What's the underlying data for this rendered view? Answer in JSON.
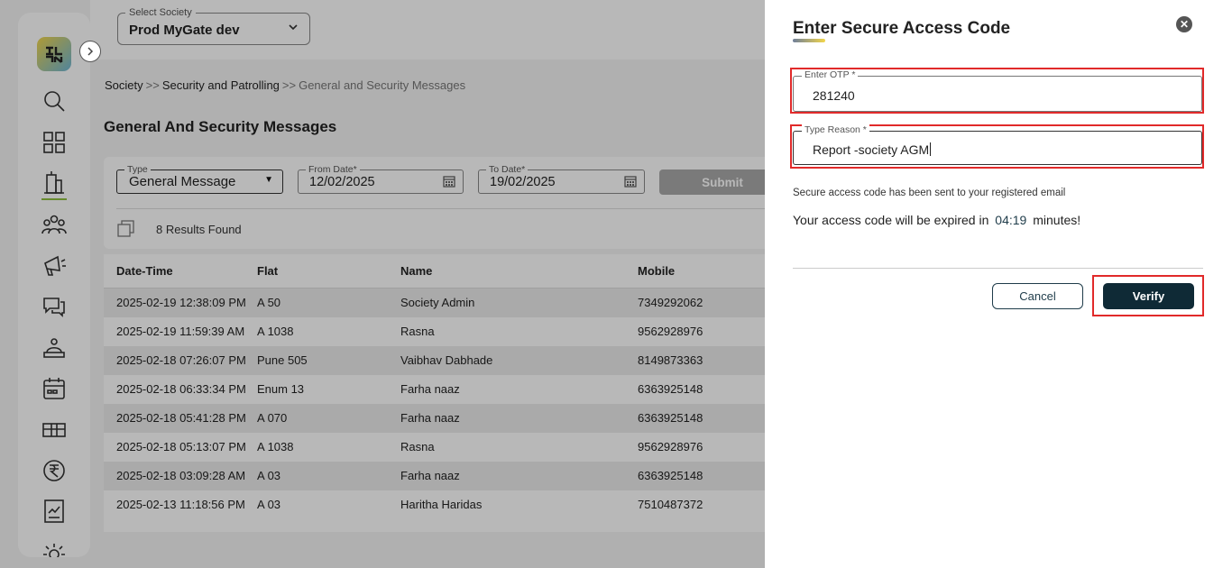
{
  "topbar": {
    "society_label": "Select Society",
    "society_value": "Prod MyGate dev"
  },
  "sidebar": {
    "logo_text": "ЯŀŊ",
    "items": [
      {
        "icon": "search-icon"
      },
      {
        "icon": "dashboard-grid-icon"
      },
      {
        "icon": "security-building-icon",
        "active": true
      },
      {
        "icon": "people-group-icon"
      },
      {
        "icon": "megaphone-icon"
      },
      {
        "icon": "chat-bubbles-icon"
      },
      {
        "icon": "helpdesk-icon"
      },
      {
        "icon": "calendar-icon"
      },
      {
        "icon": "package-icon"
      },
      {
        "icon": "rupee-icon"
      },
      {
        "icon": "report-chart-icon"
      },
      {
        "icon": "settings-icon"
      }
    ]
  },
  "breadcrumb": {
    "items": [
      "Society",
      "Security and Patrolling",
      "General and Security Messages"
    ],
    "separator": ">>"
  },
  "page": {
    "title": "General And Security Messages"
  },
  "filters": {
    "type_label": "Type",
    "type_value": "General Message",
    "from_label": "From Date*",
    "from_value": "12/02/2025",
    "to_label": "To Date*",
    "to_value": "19/02/2025",
    "submit_label": "Submit",
    "results_text": "8 Results Found"
  },
  "table": {
    "columns": [
      "Date-Time",
      "Flat",
      "Name",
      "Mobile"
    ],
    "rows": [
      [
        "2025-02-19 12:38:09 PM",
        "A 50",
        "Society Admin",
        "7349292062"
      ],
      [
        "2025-02-19 11:59:39 AM",
        "A 1038",
        "Rasna",
        "9562928976"
      ],
      [
        "2025-02-18 07:26:07 PM",
        "Pune 505",
        "Vaibhav Dabhade",
        "8149873363"
      ],
      [
        "2025-02-18 06:33:34 PM",
        "Enum 13",
        "Farha naaz",
        "6363925148"
      ],
      [
        "2025-02-18 05:41:28 PM",
        "A 070",
        "Farha naaz",
        "6363925148"
      ],
      [
        "2025-02-18 05:13:07 PM",
        "A 1038",
        "Rasna",
        "9562928976"
      ],
      [
        "2025-02-18 03:09:28 AM",
        "A 03",
        "Farha naaz",
        "6363925148"
      ],
      [
        "2025-02-13 11:18:56 PM",
        "A 03",
        "Haritha Haridas",
        "7510487372"
      ]
    ]
  },
  "drawer": {
    "title": "Enter Secure Access Code",
    "otp_label": "Enter OTP *",
    "otp_value": "281240",
    "reason_label": "Type Reason *",
    "reason_value": "Report -society AGM",
    "info_text": "Secure access code has been sent to your registered email",
    "timer_prefix": "Your access code will be expired in",
    "timer_value": "04:19",
    "timer_suffix": "minutes!",
    "cancel_label": "Cancel",
    "verify_label": "Verify",
    "highlight_color": "#e12a2a",
    "primary_color": "#0f2a36"
  }
}
